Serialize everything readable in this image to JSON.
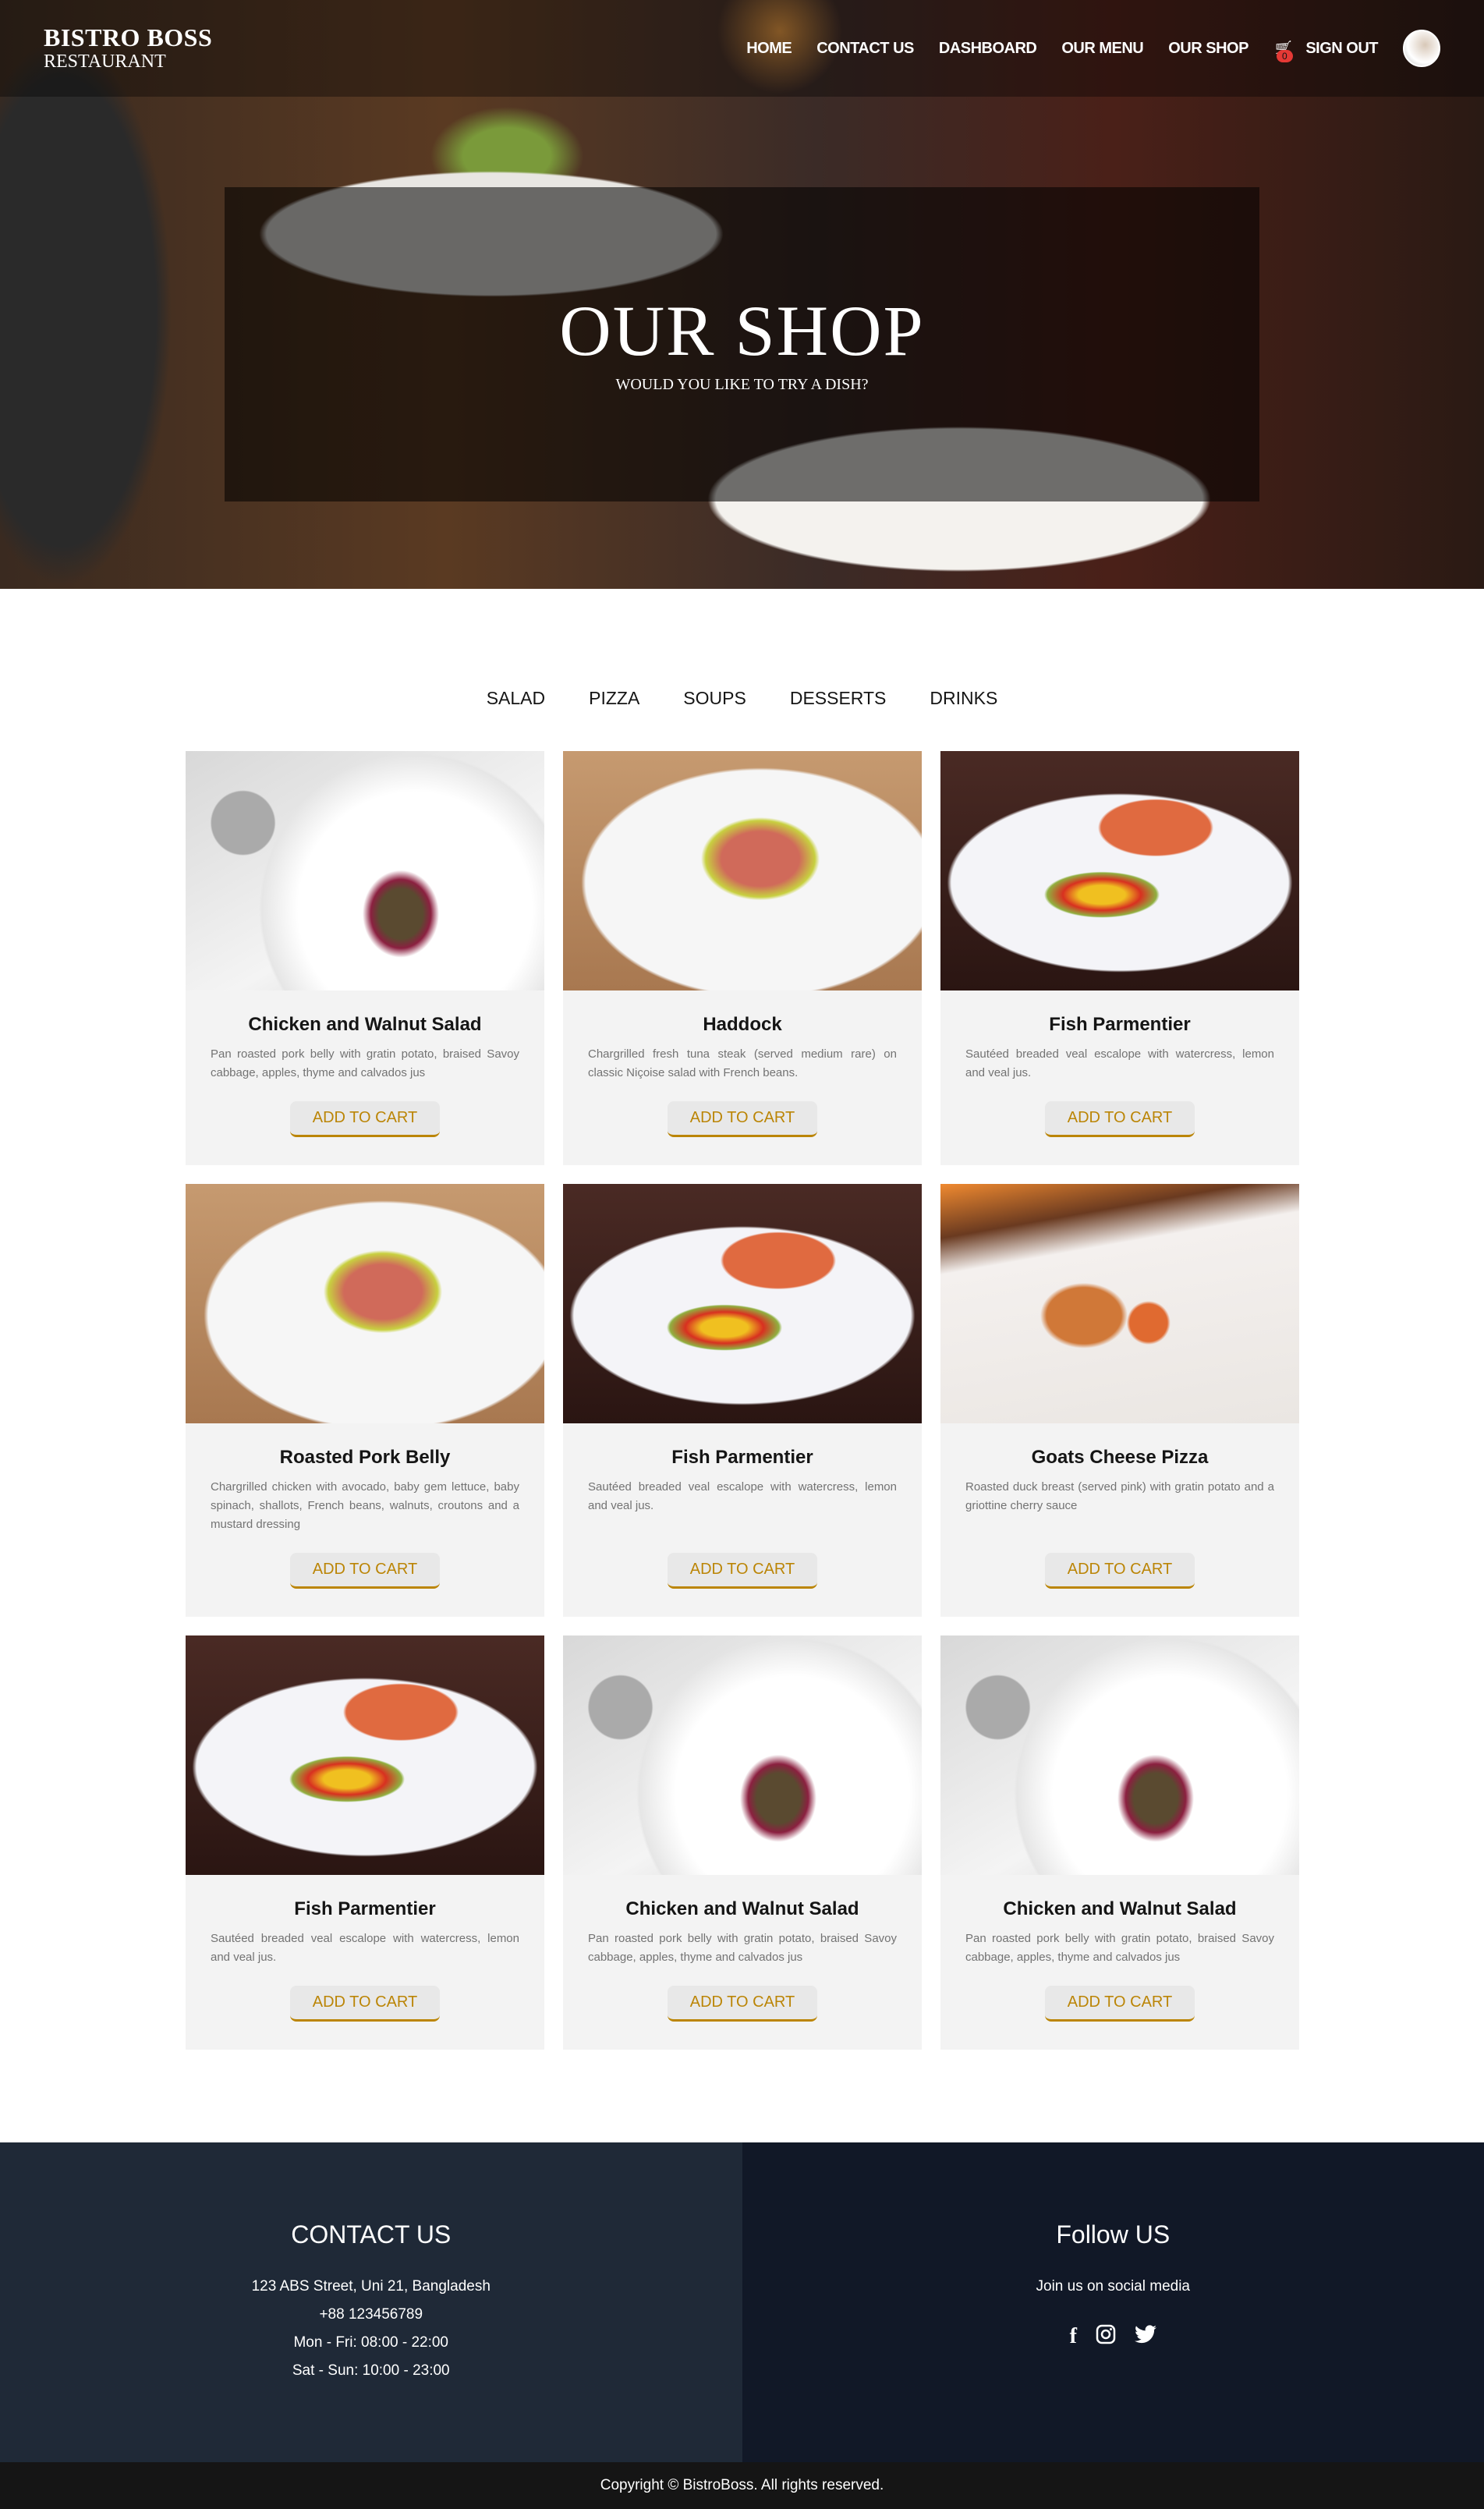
{
  "brand": {
    "line1": "BISTRO BOSS",
    "line2": "RESTAURANT"
  },
  "nav": {
    "items": [
      "HOME",
      "CONTACT US",
      "DASHBOARD",
      "OUR MENU",
      "OUR SHOP"
    ],
    "cart_count": "0",
    "sign_out": "SIGN OUT"
  },
  "hero": {
    "title": "OUR SHOP",
    "subtitle": "WOULD YOU LIKE TO TRY A DISH?"
  },
  "tabs": [
    "SALAD",
    "PIZZA",
    "SOUPS",
    "DESSERTS",
    "DRINKS"
  ],
  "button_label": "ADD TO CART",
  "items": [
    {
      "name": "Chicken and Walnut Salad",
      "desc": "Pan roasted pork belly with gratin potato, braised Savoy cabbage, apples, thyme and calvados jus",
      "image": "salad"
    },
    {
      "name": "Haddock",
      "desc": "Chargrilled fresh tuna steak (served medium rare) on classic Niçoise salad with French beans.",
      "image": "haddock"
    },
    {
      "name": "Fish Parmentier",
      "desc": "Sautéed breaded veal escalope with watercress, lemon and veal jus.",
      "image": "salmon"
    },
    {
      "name": "Roasted Pork Belly",
      "desc": "Chargrilled chicken with avocado, baby gem lettuce, baby spinach, shallots, French beans, walnuts, croutons and a mustard dressing",
      "image": "haddock"
    },
    {
      "name": "Fish Parmentier",
      "desc": "Sautéed breaded veal escalope with watercress, lemon and veal jus.",
      "image": "salmon"
    },
    {
      "name": "Goats Cheese Pizza",
      "desc": "Roasted duck breast (served pink) with gratin potato and a griottine cherry sauce",
      "image": "pizza"
    },
    {
      "name": "Fish Parmentier",
      "desc": "Sautéed breaded veal escalope with watercress, lemon and veal jus.",
      "image": "salmon"
    },
    {
      "name": "Chicken and Walnut Salad",
      "desc": "Pan roasted pork belly with gratin potato, braised Savoy cabbage, apples, thyme and calvados jus",
      "image": "salad"
    },
    {
      "name": "Chicken and Walnut Salad",
      "desc": "Pan roasted pork belly with gratin potato, braised Savoy cabbage, apples, thyme and calvados jus",
      "image": "salad"
    }
  ],
  "footer": {
    "contact_title": "CONTACT US",
    "contact_lines": [
      "123 ABS Street, Uni 21, Bangladesh",
      "+88 123456789",
      "Mon - Fri: 08:00 - 22:00",
      "Sat - Sun: 10:00 - 23:00"
    ],
    "follow_title": "Follow US",
    "follow_text": "Join us on social media",
    "copyright": "Copyright © BistroBoss. All rights reserved."
  },
  "colors": {
    "accent": "#bb8506",
    "footer_left": "#1f2937",
    "footer_right": "#111827",
    "badge": "#e53935"
  }
}
